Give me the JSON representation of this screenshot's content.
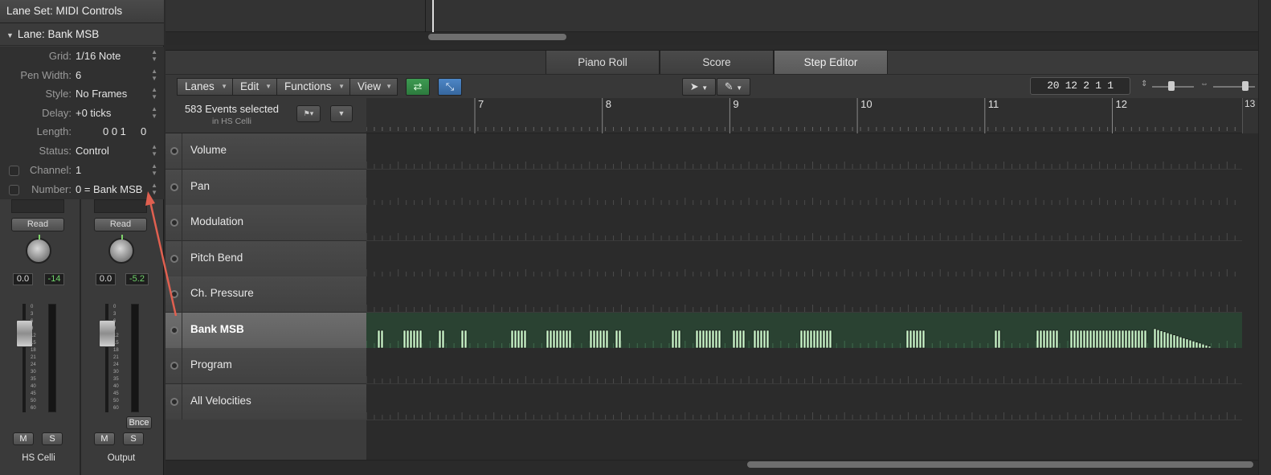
{
  "inspector": {
    "lane_set": "Lane Set: MIDI Controls",
    "lane_header": "Lane:  Bank MSB",
    "properties": [
      {
        "label": "Grid:",
        "value": "1/16 Note"
      },
      {
        "label": "Pen Width:",
        "value": "6"
      },
      {
        "label": "Style:",
        "value": "No Frames"
      },
      {
        "label": "Delay:",
        "value": "+0 ticks"
      },
      {
        "label": "Length:",
        "value": "0 0 1     0"
      },
      {
        "label": "Status:",
        "value": "Control"
      },
      {
        "label": "Channel:",
        "value": "1"
      },
      {
        "label": "Number:",
        "value": "0 = Bank MSB"
      }
    ]
  },
  "strips": [
    {
      "read": "Read",
      "pan": "0.0",
      "level": "-14",
      "mute": "M",
      "solo": "S",
      "name": "HS Celli"
    },
    {
      "read": "Read",
      "pan": "0.0",
      "level": "-5.2",
      "mute": "M",
      "solo": "S",
      "name": "Output",
      "bounce": "Bnce"
    }
  ],
  "fader_scale": [
    "0",
    "3",
    "6",
    "9",
    "12",
    "15",
    "18",
    "21",
    "24",
    "30",
    "35",
    "40",
    "45",
    "50",
    "60"
  ],
  "tabs": [
    "Piano Roll",
    "Score",
    "Step Editor"
  ],
  "active_tab": "Step Editor",
  "toolbar": {
    "menus": [
      "Lanes",
      "Edit",
      "Functions",
      "View"
    ],
    "position": "20   12 2 1 1"
  },
  "events": {
    "count_text": "583 Events selected",
    "region_text": "in HS Celli"
  },
  "ruler": {
    "bars": [
      "7",
      "8",
      "9",
      "10",
      "11",
      "12"
    ],
    "end_marker": "13"
  },
  "lanes": [
    "Volume",
    "Pan",
    "Modulation",
    "Pitch Bend",
    "Ch. Pressure",
    "Bank MSB",
    "Program",
    "All Velocities"
  ],
  "selected_lane": "Bank MSB",
  "colors": {
    "selected_lane_bg": "#2a4232",
    "event_fill": "#c8f5c8",
    "annotation_arrow": "#e06050",
    "level_green": "#6fd36a"
  }
}
